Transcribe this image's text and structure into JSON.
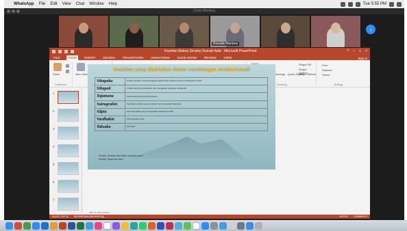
{
  "macbar": {
    "app_name": "WhatsApp",
    "menus": [
      "File",
      "Edit",
      "View",
      "Chat",
      "Window",
      "Help"
    ],
    "clock": "Tue 5:55 PM"
  },
  "zoom": {
    "window_title": "Zoom Meeting",
    "participants": [
      {
        "name": ""
      },
      {
        "name": ""
      },
      {
        "name": ""
      },
      {
        "name": "Rosalia Mariana"
      },
      {
        "name": ""
      },
      {
        "name": ""
      }
    ]
  },
  "ppt": {
    "document_title": "Kearifan Makna Struktur Rumah Adat - Microsoft PowerPoint",
    "tabs": [
      "FILE",
      "HOME",
      "INSERT",
      "DESIGN",
      "TRANSITIONS",
      "ANIMATIONS",
      "SLIDE SHOW",
      "REVIEW",
      "VIEW"
    ],
    "active_tab": "HOME",
    "sign_in": "Sign in",
    "ribbon_groups": [
      "Clipboard",
      "Slides",
      "Font",
      "Paragraph",
      "Drawing",
      "Editing"
    ],
    "ribbon_labels": {
      "paste": "Paste",
      "new_slide": "New Slide",
      "layout": "Layout",
      "reset": "Reset",
      "section": "Section",
      "picture": "Picture",
      "arrange": "Arrange",
      "quick_styles": "Quick Styles",
      "shape_fill": "Shape Fill",
      "shape_outline": "Shape Outline",
      "shape_effects": "Shape Effects",
      "find": "Find",
      "replace": "Replace",
      "select": "Select"
    },
    "thumbnail_numbers": [
      "1",
      "2",
      "3",
      "4",
      "5",
      "6",
      "7"
    ],
    "notes_placeholder": "Tap to add notes",
    "status_left": "SLIDE 1 OF 14",
    "status_lang": "INDONESIAN (INDONESIA)",
    "status_notes": "NOTES",
    "status_comments": "COMMENTS"
  },
  "slide": {
    "title": "Keahlian yang diperlukan dalam membangun struktur/candi",
    "rows": [
      {
        "term": "Sthapaka",
        "desc": "Arsitek pendeta yang bertanggung jawab atas seluruh proses pembangunan candi"
      },
      {
        "term": "Sthapati",
        "desc": "Arsitek yang merencanakan dan mengawasi pekerjaan bangunan"
      },
      {
        "term": "Tajamana",
        "desc": "Penyandang dana pembangunan"
      },
      {
        "term": "Sutragrahin",
        "desc": "Pembantu arsitek yang mengukur dan menandai bangunan"
      },
      {
        "term": "Silpin",
        "desc": "Seniman pahat yang mengerjakan ukiran dan relief"
      },
      {
        "term": "Vardhakin",
        "desc": "Ahli penyusun batu"
      },
      {
        "term": "Taksaka",
        "desc": "Pemahat"
      }
    ],
    "footnote1": "Sumber: Kearifan lokal dalam arsitektur candi",
    "footnote2": "Ilustrasi: Bangunan candi"
  }
}
